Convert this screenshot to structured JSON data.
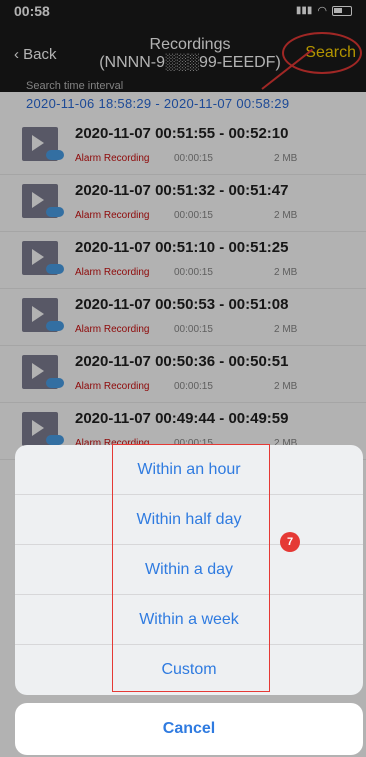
{
  "status": {
    "time": "00:58"
  },
  "nav": {
    "back_label": "Back",
    "title": "Recordings",
    "subtitle": "(NNNN-9░░░99-EEEDF)",
    "search_label": "Search"
  },
  "interval": {
    "label": "Search time interval",
    "range": "2020-11-06 18:58:29 - 2020-11-07 00:58:29"
  },
  "recordings": [
    {
      "time": "2020-11-07 00:51:55 - 00:52:10",
      "type": "Alarm Recording",
      "duration": "00:00:15",
      "size": "2 MB"
    },
    {
      "time": "2020-11-07 00:51:32 - 00:51:47",
      "type": "Alarm Recording",
      "duration": "00:00:15",
      "size": "2 MB"
    },
    {
      "time": "2020-11-07 00:51:10 - 00:51:25",
      "type": "Alarm Recording",
      "duration": "00:00:15",
      "size": "2 MB"
    },
    {
      "time": "2020-11-07 00:50:53 - 00:51:08",
      "type": "Alarm Recording",
      "duration": "00:00:15",
      "size": "2 MB"
    },
    {
      "time": "2020-11-07 00:50:36 - 00:50:51",
      "type": "Alarm Recording",
      "duration": "00:00:15",
      "size": "2 MB"
    },
    {
      "time": "2020-11-07 00:49:44 - 00:49:59",
      "type": "Alarm Recording",
      "duration": "00:00:15",
      "size": "2 MB"
    }
  ],
  "sheet": {
    "options": [
      "Within an hour",
      "Within half day",
      "Within a day",
      "Within a week",
      "Custom"
    ],
    "cancel_label": "Cancel"
  },
  "annotation": {
    "step": "7"
  }
}
